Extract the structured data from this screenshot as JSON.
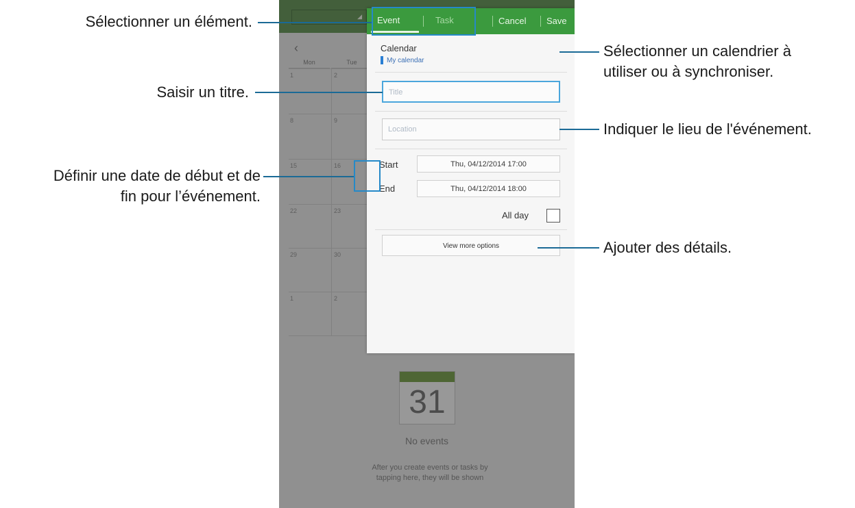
{
  "callouts": {
    "select_item": "Sélectionner un élément.",
    "enter_title": "Saisir un titre.",
    "set_dates_1": "Définir une date de début et de",
    "set_dates_2": "fin pour l’événement.",
    "select_calendar_1": "Sélectionner un calendrier à",
    "select_calendar_2": "utiliser ou à synchroniser.",
    "location": "Indiquer le lieu de l'événement.",
    "add_details": "Ajouter des détails."
  },
  "background": {
    "day_headers": [
      "Mon",
      "Tue"
    ],
    "day_numbers": [
      "1",
      "2",
      "8",
      "9",
      "15",
      "16",
      "22",
      "23",
      "29",
      "30",
      "1",
      "2"
    ],
    "widget_day": "31",
    "no_events": "No events",
    "hint": "After you create events or tasks by tapping here, they will be shown"
  },
  "dialog": {
    "tabs": {
      "event": "Event",
      "task": "Task"
    },
    "actions": {
      "cancel": "Cancel",
      "save": "Save"
    },
    "calendar": {
      "label": "Calendar",
      "value": "My calendar",
      "color": "#2a7fd4"
    },
    "title_placeholder": "Title",
    "location_placeholder": "Location",
    "start": {
      "label": "Start",
      "value": "Thu, 04/12/2014  17:00"
    },
    "end": {
      "label": "End",
      "value": "Thu, 04/12/2014  18:00"
    },
    "all_day": {
      "label": "All day",
      "checked": false
    },
    "more_options": "View more options"
  },
  "colors": {
    "header_green": "#3b9a3e",
    "callout_line": "#1a6a96",
    "highlight": "#2589c8"
  }
}
